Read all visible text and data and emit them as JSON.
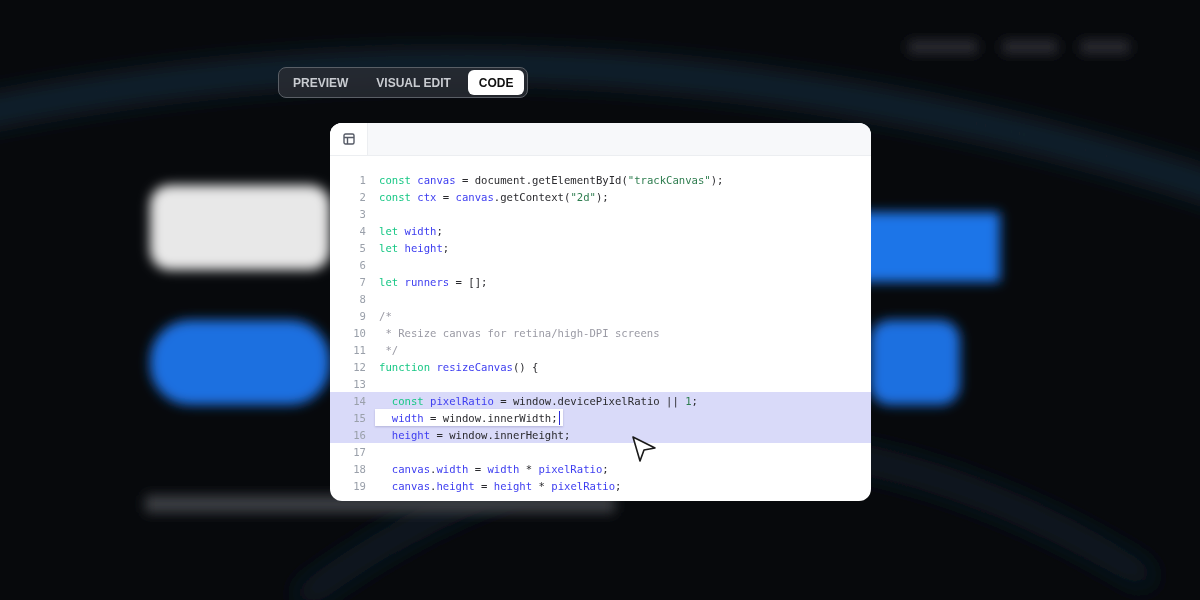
{
  "mode_tabs": [
    {
      "label": "PREVIEW",
      "selected": false
    },
    {
      "label": "VISUAL EDIT",
      "selected": false
    },
    {
      "label": "CODE",
      "selected": true
    }
  ],
  "editor": {
    "lines": [
      {
        "number": "1",
        "selected": false,
        "tokens": [
          {
            "kind": "keyword",
            "text": "const "
          },
          {
            "kind": "ident",
            "text": "canvas"
          },
          {
            "kind": "plain",
            "text": " = document.getElementById("
          },
          {
            "kind": "string",
            "text": "\"trackCanvas\""
          },
          {
            "kind": "plain",
            "text": ");"
          }
        ]
      },
      {
        "number": "2",
        "selected": false,
        "tokens": [
          {
            "kind": "keyword",
            "text": "const "
          },
          {
            "kind": "ident",
            "text": "ctx"
          },
          {
            "kind": "plain",
            "text": " = "
          },
          {
            "kind": "ident",
            "text": "canvas"
          },
          {
            "kind": "plain",
            "text": ".getContext("
          },
          {
            "kind": "string",
            "text": "\"2d\""
          },
          {
            "kind": "plain",
            "text": ");"
          }
        ]
      },
      {
        "number": "3",
        "selected": false
      },
      {
        "number": "4",
        "selected": false,
        "tokens": [
          {
            "kind": "keyword",
            "text": "let "
          },
          {
            "kind": "ident",
            "text": "width"
          },
          {
            "kind": "plain",
            "text": ";"
          }
        ]
      },
      {
        "number": "5",
        "selected": false,
        "tokens": [
          {
            "kind": "keyword",
            "text": "let "
          },
          {
            "kind": "ident",
            "text": "height"
          },
          {
            "kind": "plain",
            "text": ";"
          }
        ]
      },
      {
        "number": "6",
        "selected": false
      },
      {
        "number": "7",
        "selected": false,
        "tokens": [
          {
            "kind": "keyword",
            "text": "let "
          },
          {
            "kind": "ident",
            "text": "runners"
          },
          {
            "kind": "plain",
            "text": " = [];"
          }
        ]
      },
      {
        "number": "8",
        "selected": false
      },
      {
        "number": "9",
        "selected": false,
        "tokens": [
          {
            "kind": "comment",
            "text": "/*"
          }
        ]
      },
      {
        "number": "10",
        "selected": false,
        "tokens": [
          {
            "kind": "comment",
            "text": " * Resize canvas for retina/high-DPI screens"
          }
        ]
      },
      {
        "number": "11",
        "selected": false,
        "tokens": [
          {
            "kind": "comment",
            "text": " */"
          }
        ]
      },
      {
        "number": "12",
        "selected": false,
        "tokens": [
          {
            "kind": "keyword",
            "text": "function "
          },
          {
            "kind": "ident",
            "text": "resizeCanvas"
          },
          {
            "kind": "plain",
            "text": "() {"
          }
        ]
      },
      {
        "number": "13",
        "selected": false
      },
      {
        "number": "14",
        "selected": true,
        "tokens": [
          {
            "kind": "keyword",
            "text": "  const "
          },
          {
            "kind": "ident",
            "text": "pixelRatio"
          },
          {
            "kind": "plain",
            "text": " = window.devicePixelRatio || "
          },
          {
            "kind": "number",
            "text": "1"
          },
          {
            "kind": "plain",
            "text": ";"
          }
        ]
      },
      {
        "number": "15",
        "selected": true,
        "editing": true,
        "tokens": [
          {
            "kind": "ident",
            "text": "  width"
          },
          {
            "kind": "plain",
            "text": " = window.innerWidth;"
          }
        ]
      },
      {
        "number": "16",
        "selected": true,
        "tokens": [
          {
            "kind": "ident",
            "text": "  height"
          },
          {
            "kind": "plain",
            "text": " = window.innerHeight;"
          }
        ]
      },
      {
        "number": "17",
        "selected": false
      },
      {
        "number": "18",
        "selected": false,
        "tokens": [
          {
            "kind": "ident",
            "text": "  canvas"
          },
          {
            "kind": "plain",
            "text": "."
          },
          {
            "kind": "ident",
            "text": "width"
          },
          {
            "kind": "plain",
            "text": " = "
          },
          {
            "kind": "ident",
            "text": "width"
          },
          {
            "kind": "plain",
            "text": " * "
          },
          {
            "kind": "ident",
            "text": "pixelRatio"
          },
          {
            "kind": "plain",
            "text": ";"
          }
        ]
      },
      {
        "number": "19",
        "selected": false,
        "tokens": [
          {
            "kind": "ident",
            "text": "  canvas"
          },
          {
            "kind": "plain",
            "text": "."
          },
          {
            "kind": "ident",
            "text": "height"
          },
          {
            "kind": "plain",
            "text": " = "
          },
          {
            "kind": "ident",
            "text": "height"
          },
          {
            "kind": "plain",
            "text": " * "
          },
          {
            "kind": "ident",
            "text": "pixelRatio"
          },
          {
            "kind": "plain",
            "text": ";"
          }
        ]
      }
    ]
  }
}
